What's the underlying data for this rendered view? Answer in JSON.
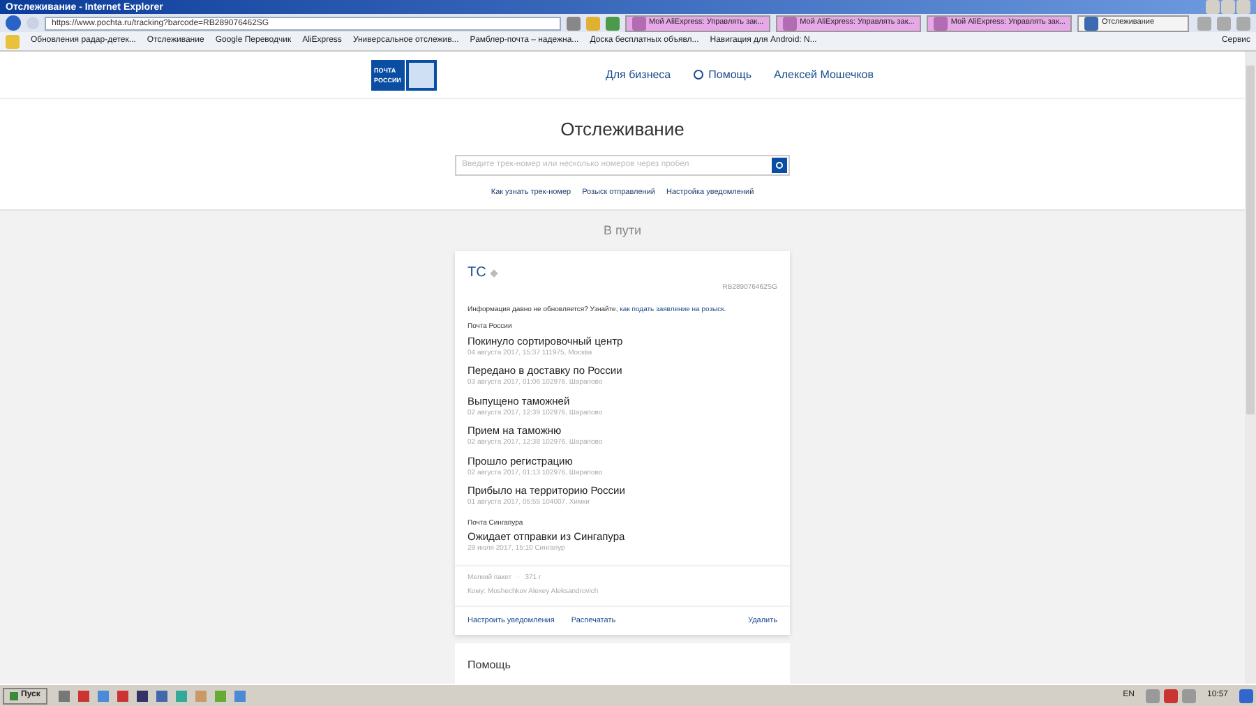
{
  "window": {
    "title": "Отслеживание - Internet Explorer"
  },
  "address_bar": {
    "url": "https://www.pochta.ru/tracking?barcode=RB289076462SG"
  },
  "tabs": [
    {
      "label": "Мой AliExpress: Управлять зак...",
      "selected": false
    },
    {
      "label": "Мой AliExpress: Управлять зак...",
      "selected": false
    },
    {
      "label": "Мой AliExpress: Управлять зак...",
      "selected": false
    },
    {
      "label": "Отслеживание",
      "selected": true
    }
  ],
  "favorites": [
    "Обновления радар-детек...",
    "Отслеживание",
    "Google Переводчик",
    "AliExpress",
    "Универсальное отслежив...",
    "Рамблер-почта – надежна...",
    "Доска бесплатных объявл...",
    "Навигация для Android: N..."
  ],
  "tools_menu": "Сервис",
  "header": {
    "logo": [
      "ПОЧТА",
      "РОССИИ"
    ],
    "nav": [
      "Для бизнеса",
      "Помощь",
      "Алексей Мошечков"
    ]
  },
  "tracking": {
    "title": "Отслеживание",
    "search": {
      "placeholder": "Введите трек-номер или несколько номеров через пробел"
    },
    "links": [
      "Как узнать трек-номер",
      "Розыск отправлений",
      "Настройка уведомлений"
    ]
  },
  "section_title": "В пути",
  "parcel": {
    "name": "ТС",
    "barcode": "RB289076462SG",
    "notice": "Информация давно не обновляется? Узнайте, ",
    "notice_link": "как подать заявление на розыск.",
    "groups": [
      {
        "carrier": "Почта России",
        "events": [
          {
            "status": "Покинуло сортировочный центр",
            "meta": "04 августа 2017, 15:37 111975, Москва"
          },
          {
            "status": "Передано в доставку по России",
            "meta": "03 августа 2017, 01:06 102976, Шарапово"
          },
          {
            "status": "Выпущено таможней",
            "meta": "02 августа 2017, 12:39 102976, Шарапово"
          },
          {
            "status": "Прием на таможню",
            "meta": "02 августа 2017, 12:38 102976, Шарапово"
          },
          {
            "status": "Прошло регистрацию",
            "meta": "02 августа 2017, 01:13 102976, Шарапово"
          },
          {
            "status": "Прибыло на территорию России",
            "meta": "01 августа 2017, 05:55 104007, Химки"
          }
        ]
      },
      {
        "carrier": "Почта Сингапура",
        "events": [
          {
            "status": "Ожидает отправки из Сингапура",
            "meta": "29 июля 2017, 15:10 Сингапур"
          }
        ]
      }
    ],
    "type": "Мелкий пакет",
    "separator": "·",
    "weight": "371 г",
    "recipient": "Кому: Moshechkov Alexey Aleksandrovich",
    "actions": [
      "Настроить уведомления",
      "Распечатать"
    ],
    "delete": "Удалить"
  },
  "help_card": {
    "title": "Помощь"
  },
  "taskbar": {
    "start": "Пуск",
    "language": "EN",
    "clock": "10:57"
  }
}
